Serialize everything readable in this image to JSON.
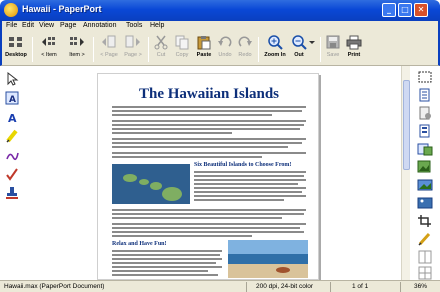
{
  "window": {
    "title": "Hawaii - PaperPort",
    "app_icon": "paperport-app-icon"
  },
  "menu": [
    "File",
    "Edit",
    "View",
    "Page",
    "Annotation",
    "Tools",
    "Help"
  ],
  "toolbar": {
    "desktop": "Desktop",
    "item_back": "< Item",
    "item_forward": "Item >",
    "page_back": "< Page",
    "page_forward": "Page >",
    "cut": "Cut",
    "copy": "Copy",
    "paste": "Paste",
    "undo": "Undo",
    "redo": "Redo",
    "zoom_in": "Zoom In",
    "zoom_out": "Out",
    "save": "Save",
    "print": "Print"
  },
  "document": {
    "title": "The Hawaiian Islands",
    "section1": "Six Beautiful Islands to Choose From!",
    "section2": "Relax and Have Fun!"
  },
  "status": {
    "filename": "Hawaii.max (PaperPort Document)",
    "resolution": "200 dpi, 24-bit color",
    "page": "1 of 1",
    "zoom": "36%"
  },
  "colors": {
    "titlebar": "#0a48d6",
    "chrome": "#ece9d8",
    "doc_heading": "#0d2f7a",
    "close_button": "#d8512a"
  }
}
